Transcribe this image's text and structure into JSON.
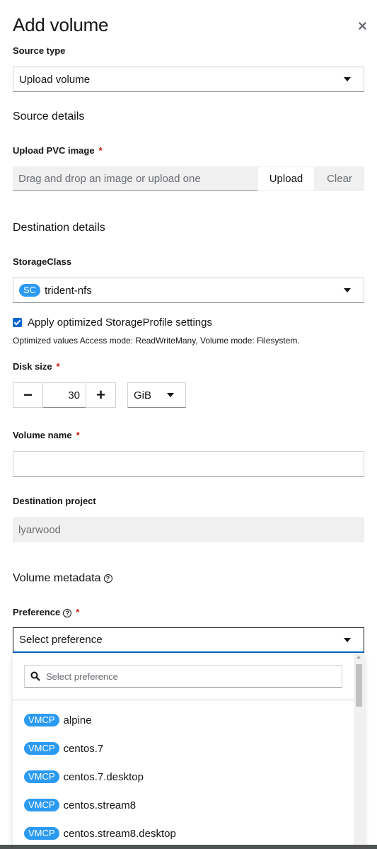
{
  "modal": {
    "title": "Add volume",
    "close_label": "×"
  },
  "source_type": {
    "label": "Source type",
    "value": "Upload volume"
  },
  "source_details": {
    "heading": "Source details",
    "upload_label": "Upload PVC image",
    "required_mark": "*",
    "placeholder": "Drag and drop an image or upload one",
    "upload_button": "Upload",
    "clear_button": "Clear"
  },
  "destination": {
    "heading": "Destination details",
    "storage_class_label": "StorageClass",
    "storage_class_badge": "SC",
    "storage_class_value": "trident-nfs",
    "apply_label": "Apply optimized StorageProfile settings",
    "apply_checked": true,
    "helper_text": "Optimized values Access mode: ReadWriteMany, Volume mode: Filesystem.",
    "disk_size_label": "Disk size",
    "disk_size_value": "30",
    "minus": "−",
    "plus": "+",
    "unit": "GiB",
    "volume_name_label": "Volume name",
    "project_label": "Destination project",
    "project_value": "lyarwood"
  },
  "metadata": {
    "heading": "Volume metadata",
    "preference_label": "Preference",
    "preference_value": "Select preference",
    "search_placeholder": "Select preference",
    "items": [
      {
        "badge": "VMCP",
        "label": "alpine"
      },
      {
        "badge": "VMCP",
        "label": "centos.7"
      },
      {
        "badge": "VMCP",
        "label": "centos.7.desktop"
      },
      {
        "badge": "VMCP",
        "label": "centos.stream8"
      },
      {
        "badge": "VMCP",
        "label": "centos.stream8.desktop"
      }
    ]
  },
  "colors": {
    "accent": "#0066cc",
    "badge": "#2b9af3",
    "required": "#c9190b"
  }
}
